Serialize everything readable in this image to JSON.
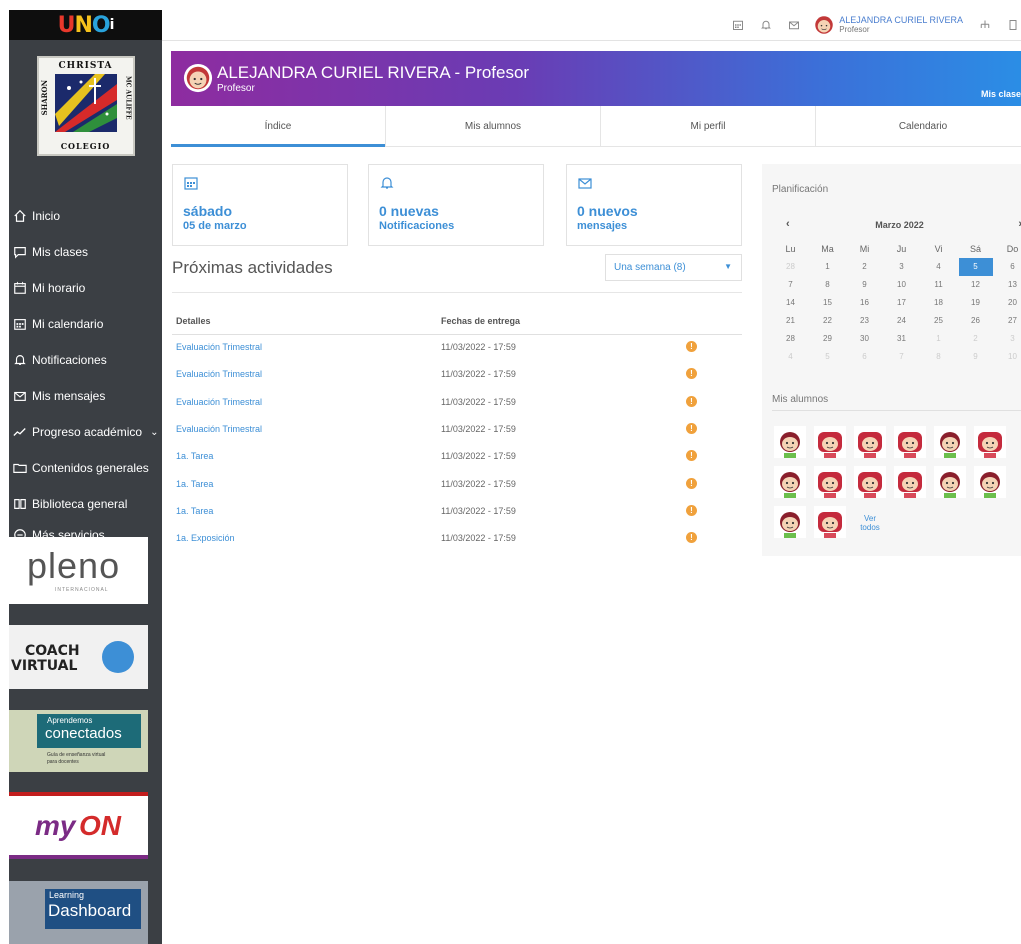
{
  "brand": {
    "logo_text": "UNOi"
  },
  "crest": {
    "top": "CHRISTA",
    "left": "SHARON",
    "right": "MC AULIFFE",
    "bottom": "COLEGIO"
  },
  "sidebar": {
    "items": [
      {
        "label": "Inicio",
        "icon": "home-icon"
      },
      {
        "label": "Mis clases",
        "icon": "chat-icon"
      },
      {
        "label": "Mi horario",
        "icon": "schedule-icon"
      },
      {
        "label": "Mi calendario",
        "icon": "calendar-icon"
      },
      {
        "label": "Notificaciones",
        "icon": "bell-icon"
      },
      {
        "label": "Mis mensajes",
        "icon": "mail-icon"
      },
      {
        "label": "Progreso académico",
        "icon": "trend-icon"
      },
      {
        "label": "Contenidos generales",
        "icon": "folder-icon"
      },
      {
        "label": "Biblioteca general",
        "icon": "book-icon"
      },
      {
        "label": "Más servicios",
        "icon": "minus-circle-icon"
      }
    ],
    "promos": {
      "pleno": "pleno",
      "pleno_sub": "INTERNACIONAL",
      "coach_line1": "COACH",
      "coach_line2": "VIRTUAL",
      "aprendemos_line1": "Aprendemos",
      "aprendemos_line2": "conectados",
      "aprendemos_line3": "Guía de enseñanza virtual",
      "aprendemos_line4": "para docentes",
      "myon_a": "my",
      "myon_b": "ON",
      "dashboard_line1": "Learning",
      "dashboard_line2": "Dashboard"
    }
  },
  "topbar": {
    "user_name": "ALEJANDRA CURIEL RIVERA",
    "user_role": "Profesor"
  },
  "header": {
    "name": "ALEJANDRA CURIEL RIVERA - Profesor",
    "role": "Profesor",
    "link": "Mis clase"
  },
  "tabs": [
    "Índice",
    "Mis alumnos",
    "Mi perfil",
    "Calendario"
  ],
  "cards": {
    "date_big": "sábado",
    "date_small": "05 de marzo",
    "notif_big": "0 nuevas",
    "notif_small": "Notificaciones",
    "msg_big": "0 nuevos",
    "msg_small": "mensajes"
  },
  "activities": {
    "title": "Próximas actividades",
    "filter": "Una semana (8)",
    "col_details": "Detalles",
    "col_dates": "Fechas de entrega",
    "rows": [
      {
        "name": "Evaluación Trimestral",
        "date": "11/03/2022 - 17:59"
      },
      {
        "name": "Evaluación Trimestral",
        "date": "11/03/2022 - 17:59"
      },
      {
        "name": "Evaluación Trimestral",
        "date": "11/03/2022 - 17:59"
      },
      {
        "name": "Evaluación Trimestral",
        "date": "11/03/2022 - 17:59"
      },
      {
        "name": "1a. Tarea",
        "date": "11/03/2022 - 17:59"
      },
      {
        "name": "1a. Tarea",
        "date": "11/03/2022 - 17:59"
      },
      {
        "name": "1a. Tarea",
        "date": "11/03/2022 - 17:59"
      },
      {
        "name": "1a. Exposición",
        "date": "11/03/2022 - 17:59"
      }
    ]
  },
  "planning": {
    "title": "Planificación",
    "month": "Marzo 2022",
    "prev": "‹",
    "next": "›",
    "weekdays": [
      "Lu",
      "Ma",
      "Mi",
      "Ju",
      "Vi",
      "Sá",
      "Do"
    ],
    "weeks": [
      [
        "28",
        "1",
        "2",
        "3",
        "4",
        "5",
        "6"
      ],
      [
        "7",
        "8",
        "9",
        "10",
        "11",
        "12",
        "13"
      ],
      [
        "14",
        "15",
        "16",
        "17",
        "18",
        "19",
        "20"
      ],
      [
        "21",
        "22",
        "23",
        "24",
        "25",
        "26",
        "27"
      ],
      [
        "28",
        "29",
        "30",
        "31",
        "1",
        "2",
        "3"
      ],
      [
        "4",
        "5",
        "6",
        "7",
        "8",
        "9",
        "10"
      ]
    ],
    "selected_day": "5"
  },
  "students": {
    "title": "Mis alumnos",
    "see_all_1": "Ver",
    "see_all_2": "todos",
    "count": 14
  },
  "colors": {
    "accent": "#3d8fd6",
    "sidebar": "#3b3f44",
    "warning": "#f0a13c"
  }
}
